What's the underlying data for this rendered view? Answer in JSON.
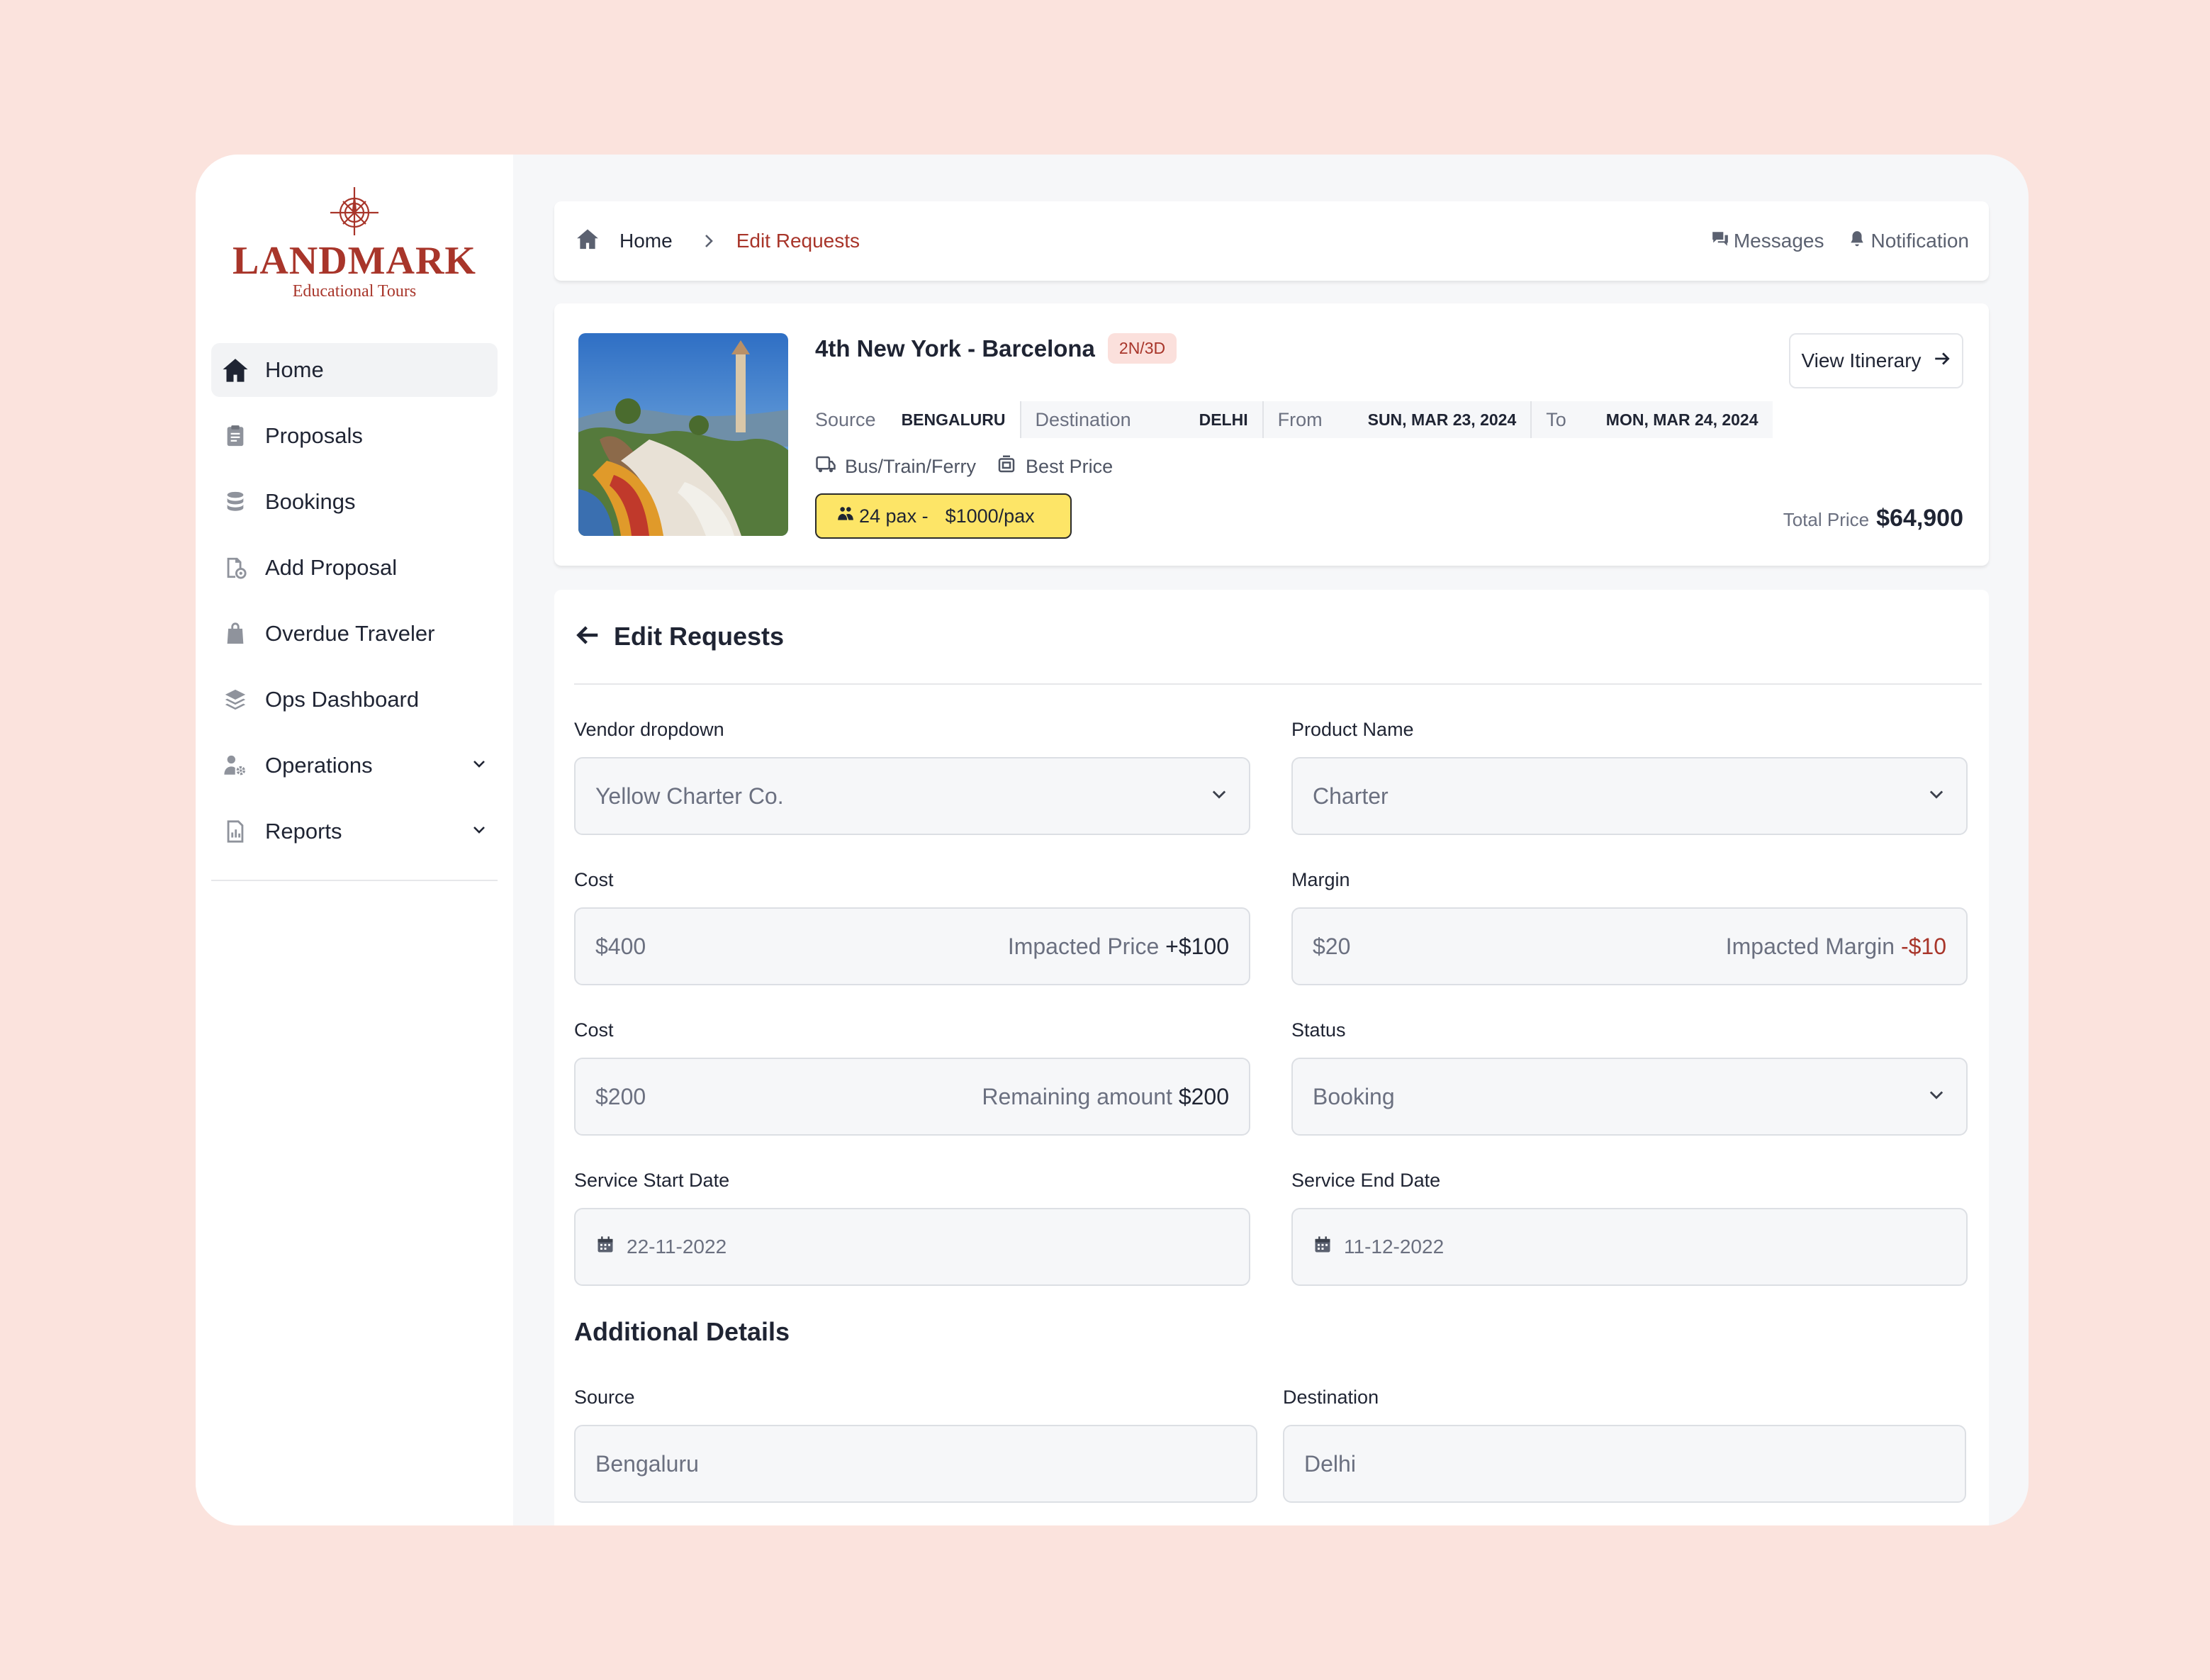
{
  "brand": {
    "name": "LANDMARK",
    "tagline": "Educational Tours",
    "color": "#a8352a"
  },
  "sidebar": {
    "items": [
      {
        "label": "Home",
        "icon": "home-icon",
        "active": true
      },
      {
        "label": "Proposals",
        "icon": "clipboard-icon"
      },
      {
        "label": "Bookings",
        "icon": "database-icon"
      },
      {
        "label": "Add Proposal",
        "icon": "add-document-icon"
      },
      {
        "label": "Overdue Traveler",
        "icon": "bag-icon"
      },
      {
        "label": "Ops Dashboard",
        "icon": "layers-icon"
      },
      {
        "label": "Operations",
        "icon": "user-gear-icon",
        "expandable": true
      },
      {
        "label": "Reports",
        "icon": "report-icon",
        "expandable": true
      }
    ]
  },
  "topbar": {
    "breadcrumb": {
      "home": "Home",
      "current": "Edit Requests"
    },
    "messages": "Messages",
    "notification": "Notification"
  },
  "trip": {
    "title": "4th New York - Barcelona",
    "duration_badge": "2N/3D",
    "source_label": "Source",
    "source": "BENGALURU",
    "destination_label": "Destination",
    "destination": "DELHI",
    "from_label": "From",
    "from": "SUN, MAR 23, 2024",
    "to_label": "To",
    "to": "MON, MAR 24, 2024",
    "transport": "Bus/Train/Ferry",
    "price_tag": "Best Price",
    "pax": "24 pax -",
    "per_pax": "$1000/pax",
    "view_itinerary": "View Itinerary",
    "total_label": "Total Price",
    "total": "$64,900"
  },
  "form": {
    "title": "Edit Requests",
    "vendor": {
      "label": "Vendor dropdown",
      "value": "Yellow Charter Co."
    },
    "product": {
      "label": "Product Name",
      "value": "Charter"
    },
    "cost1": {
      "label": "Cost",
      "value": "$400",
      "impact_label": "Impacted Price",
      "impact_value": "+$100"
    },
    "margin": {
      "label": "Margin",
      "value": "$20",
      "impact_label": "Impacted Margin",
      "impact_value": "-$10"
    },
    "cost2": {
      "label": "Cost",
      "value": "$200",
      "remain_label": "Remaining amount",
      "remain_value": "$200"
    },
    "status": {
      "label": "Status",
      "value": "Booking"
    },
    "start_date": {
      "label": "Service Start Date",
      "value": "22-11-2022"
    },
    "end_date": {
      "label": "Service End Date",
      "value": "11-12-2022"
    },
    "additional_title": "Additional Details",
    "add_source": {
      "label": "Source",
      "value": "Bengaluru"
    },
    "add_destination": {
      "label": "Destination",
      "value": "Delhi"
    }
  }
}
